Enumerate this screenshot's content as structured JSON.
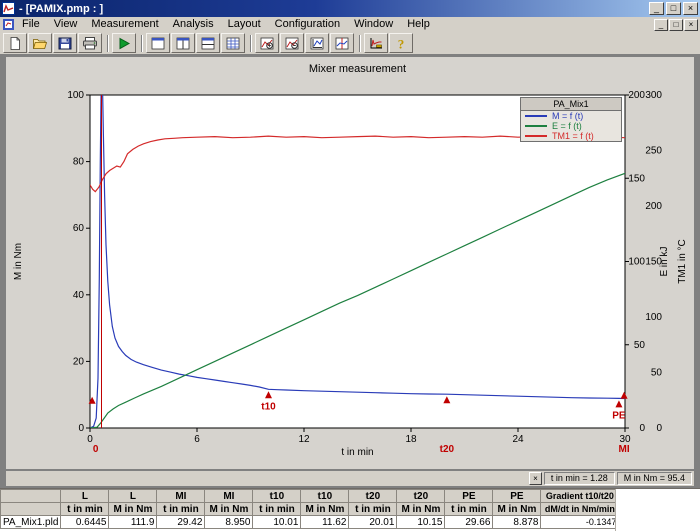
{
  "window": {
    "title": "- [PAMIX.pmp : ]",
    "icon": "app-icon",
    "buttons": {
      "minimize": "_",
      "maximize": "□",
      "close": "×"
    }
  },
  "menu": {
    "items": [
      "File",
      "View",
      "Measurement",
      "Analysis",
      "Layout",
      "Configuration",
      "Window",
      "Help"
    ],
    "mdi_buttons": {
      "minimize": "_",
      "restore": "□",
      "close": "×"
    }
  },
  "toolbar": {
    "buttons": [
      {
        "icon": "new-document-icon",
        "group": 1
      },
      {
        "icon": "open-file-icon",
        "group": 1
      },
      {
        "icon": "save-icon",
        "group": 1
      },
      {
        "icon": "print-icon",
        "group": 1
      },
      {
        "icon": "start-measurement-icon",
        "group": 2
      },
      {
        "icon": "layout-single-icon",
        "group": 3
      },
      {
        "icon": "layout-vertical-split-icon",
        "group": 3
      },
      {
        "icon": "layout-horizontal-split-icon",
        "group": 3
      },
      {
        "icon": "layout-table-icon",
        "group": 3
      },
      {
        "icon": "chart-zoom-in-icon",
        "group": 4
      },
      {
        "icon": "chart-zoom-out-icon",
        "group": 4
      },
      {
        "icon": "chart-scale-icon",
        "group": 4
      },
      {
        "icon": "chart-cursor-icon",
        "group": 4
      },
      {
        "icon": "evaluation-icon",
        "group": 5
      },
      {
        "icon": "help-icon",
        "group": 5
      }
    ]
  },
  "status": {
    "cursor_t": "t in min = 1.28",
    "cursor_m": "M in Nm = 95.4"
  },
  "table": {
    "header_row1": [
      "",
      "L",
      "L",
      "MI",
      "MI",
      "t10",
      "t10",
      "t20",
      "t20",
      "PE",
      "PE",
      "Gradient t10/t20"
    ],
    "header_row2": [
      "",
      "t in min",
      "M in Nm",
      "t in min",
      "M in Nm",
      "t in min",
      "M in Nm",
      "t in min",
      "M in Nm",
      "t in min",
      "M in Nm",
      "dM/dt in Nm/min"
    ],
    "rows": [
      [
        "PA_Mix1.pld",
        "0.6445",
        "111.9",
        "29.42",
        "8.950",
        "10.01",
        "11.62",
        "20.01",
        "10.15",
        "29.66",
        "8.878",
        "-0.1347"
      ]
    ]
  },
  "chart_data": {
    "type": "line",
    "title": "Mixer measurement",
    "x_axis": {
      "label": "t in min",
      "min": 0,
      "max": 30,
      "ticks": [
        0,
        6,
        12,
        18,
        24,
        30
      ]
    },
    "y_axes": [
      {
        "id": "M",
        "label": "M in Nm",
        "min": 0,
        "max": 100,
        "ticks": [
          0,
          20,
          40,
          60,
          80,
          100
        ],
        "side": "left"
      },
      {
        "id": "E",
        "label": "E in kJ",
        "min": 0,
        "max": 200,
        "ticks": [
          0,
          50,
          100,
          150,
          200
        ],
        "side": "right"
      },
      {
        "id": "TM1",
        "label": "TM1 in °C",
        "min": 0,
        "max": 300,
        "ticks": [
          0,
          50,
          100,
          150,
          200,
          250,
          300
        ],
        "side": "right2"
      }
    ],
    "legend": {
      "title": "PA_Mix1",
      "entries": [
        {
          "label": "M = f (t)",
          "color": "#2a3cb8"
        },
        {
          "label": "E = f (t)",
          "color": "#1e8040"
        },
        {
          "label": "TM1 = f (t)",
          "color": "#d42a2a"
        }
      ]
    },
    "marker_line": {
      "t": 0.6445,
      "color": "#c00000"
    },
    "markers": [
      {
        "t": 0.12,
        "value": 10,
        "axis": "M",
        "label": ""
      },
      {
        "t": 0.6445,
        "axis": "M",
        "label": "0",
        "label_pos": "below-axis",
        "align": "end"
      },
      {
        "t": 10.01,
        "value": 11.62,
        "axis": "M",
        "label": "t10",
        "label_pos": "below-point"
      },
      {
        "t": 20.01,
        "value": 10.15,
        "axis": "M",
        "label": "t20",
        "label_pos": "below-axis"
      },
      {
        "t": 29.66,
        "value": 8.878,
        "axis": "M",
        "label": "PE",
        "label_pos": "below-point"
      },
      {
        "t": 29.95,
        "value": 11.5,
        "axis": "M",
        "label": "MI",
        "label_pos": "below-axis"
      }
    ],
    "series": [
      {
        "name": "M",
        "axis": "M",
        "color": "#2a3cb8",
        "points": [
          [
            0,
            0
          ],
          [
            0.2,
            0.5
          ],
          [
            0.35,
            3
          ],
          [
            0.45,
            15
          ],
          [
            0.52,
            45
          ],
          [
            0.58,
            80
          ],
          [
            0.6445,
            111.9
          ],
          [
            0.7,
            103
          ],
          [
            0.75,
            88
          ],
          [
            0.82,
            70
          ],
          [
            0.9,
            55
          ],
          [
            1.0,
            44
          ],
          [
            1.1,
            37
          ],
          [
            1.25,
            30.5
          ],
          [
            1.4,
            27
          ],
          [
            1.6,
            24.5
          ],
          [
            1.8,
            23
          ],
          [
            2.0,
            21.8
          ],
          [
            2.3,
            20.6
          ],
          [
            2.6,
            19.8
          ],
          [
            3.0,
            19
          ],
          [
            3.5,
            18.2
          ],
          [
            4,
            17.4
          ],
          [
            4.5,
            16.8
          ],
          [
            5,
            16.2
          ],
          [
            5.5,
            15.7
          ],
          [
            6,
            15.2
          ],
          [
            6.5,
            14.8
          ],
          [
            7,
            14.4
          ],
          [
            7.5,
            14
          ],
          [
            8,
            13.6
          ],
          [
            8.5,
            13.2
          ],
          [
            9,
            12.8
          ],
          [
            9.5,
            12.3
          ],
          [
            10.01,
            11.62
          ],
          [
            10.5,
            11.5
          ],
          [
            11,
            11.4
          ],
          [
            12,
            11.2
          ],
          [
            13,
            11.05
          ],
          [
            14,
            10.9
          ],
          [
            15,
            10.75
          ],
          [
            16,
            10.6
          ],
          [
            17,
            10.45
          ],
          [
            18,
            10.3
          ],
          [
            19,
            10.2
          ],
          [
            20.01,
            10.15
          ],
          [
            21,
            10
          ],
          [
            22,
            9.85
          ],
          [
            23,
            9.7
          ],
          [
            24,
            9.55
          ],
          [
            25,
            9.4
          ],
          [
            26,
            9.25
          ],
          [
            27,
            9.1
          ],
          [
            28,
            9
          ],
          [
            29,
            8.94
          ],
          [
            29.66,
            8.878
          ],
          [
            30,
            8.86
          ]
        ]
      },
      {
        "name": "E",
        "axis": "E",
        "color": "#1e8040",
        "points": [
          [
            0,
            0
          ],
          [
            0.4,
            0.5
          ],
          [
            0.6,
            3
          ],
          [
            0.8,
            6
          ],
          [
            1.0,
            9
          ],
          [
            1.3,
            11.5
          ],
          [
            1.6,
            13.5
          ],
          [
            2,
            15.5
          ],
          [
            2.5,
            18
          ],
          [
            3,
            20.5
          ],
          [
            4,
            25
          ],
          [
            5,
            30
          ],
          [
            6,
            35
          ],
          [
            7,
            40
          ],
          [
            8,
            45
          ],
          [
            9,
            50
          ],
          [
            10,
            55
          ],
          [
            11,
            60
          ],
          [
            12,
            65
          ],
          [
            13,
            70
          ],
          [
            14,
            75
          ],
          [
            15,
            79.5
          ],
          [
            16,
            84.5
          ],
          [
            17,
            89.5
          ],
          [
            18,
            94.5
          ],
          [
            19,
            99.5
          ],
          [
            20,
            104.5
          ],
          [
            21,
            109.5
          ],
          [
            22,
            114.5
          ],
          [
            23,
            119.5
          ],
          [
            24,
            124.5
          ],
          [
            25,
            129.5
          ],
          [
            26,
            134.5
          ],
          [
            27,
            139.5
          ],
          [
            28,
            144.5
          ],
          [
            29,
            149
          ],
          [
            30,
            153
          ]
        ]
      },
      {
        "name": "TM1",
        "axis": "TM1",
        "color": "#d42a2a",
        "points": [
          [
            0,
            219
          ],
          [
            0.15,
            215
          ],
          [
            0.3,
            213
          ],
          [
            0.5,
            217
          ],
          [
            0.7,
            224
          ],
          [
            0.9,
            229
          ],
          [
            1.1,
            232
          ],
          [
            1.3,
            234
          ],
          [
            1.5,
            236
          ],
          [
            1.7,
            235
          ],
          [
            1.9,
            240
          ],
          [
            2.1,
            247
          ],
          [
            2.4,
            251
          ],
          [
            2.7,
            254
          ],
          [
            3,
            256
          ],
          [
            3.4,
            258
          ],
          [
            3.8,
            259.5
          ],
          [
            4.2,
            260.5
          ],
          [
            4.7,
            261
          ],
          [
            5.2,
            261.5
          ],
          [
            6,
            262
          ],
          [
            7,
            262.5
          ],
          [
            8,
            261.5
          ],
          [
            9,
            262
          ],
          [
            10,
            263
          ],
          [
            11,
            262
          ],
          [
            12,
            262.5
          ],
          [
            13,
            261.5
          ],
          [
            14,
            262
          ],
          [
            15,
            262.5
          ],
          [
            16,
            263
          ],
          [
            17,
            262
          ],
          [
            18,
            262.5
          ],
          [
            19,
            261.5
          ],
          [
            20,
            262
          ],
          [
            21,
            262.5
          ],
          [
            22,
            262
          ],
          [
            23,
            263
          ],
          [
            24,
            262
          ],
          [
            25,
            262.5
          ],
          [
            26,
            261.5
          ],
          [
            27,
            262
          ],
          [
            28,
            262.5
          ],
          [
            29,
            262
          ],
          [
            30,
            261.5
          ]
        ]
      }
    ]
  }
}
